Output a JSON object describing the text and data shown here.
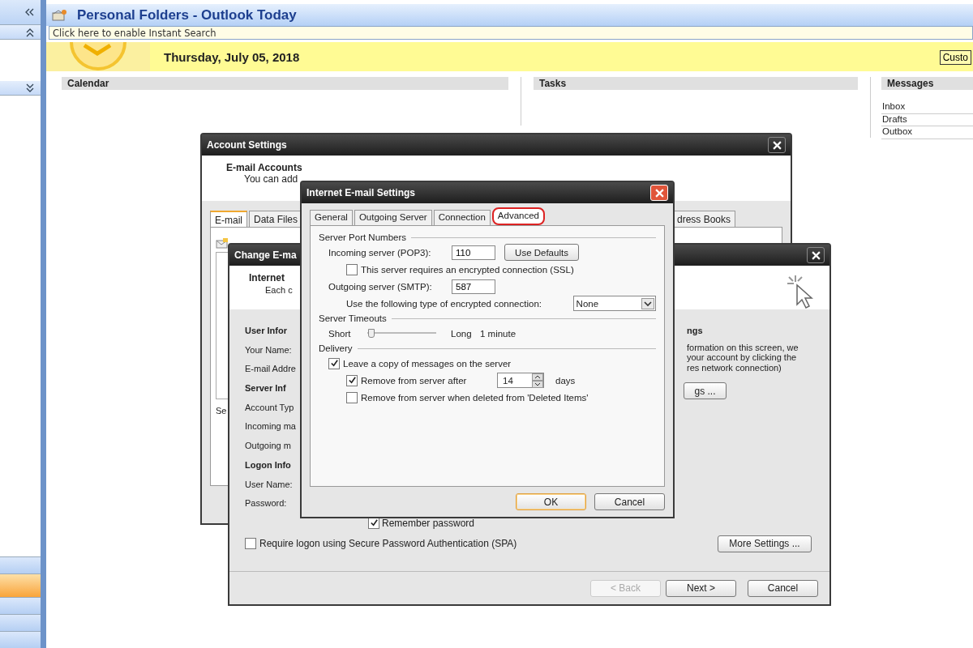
{
  "header": {
    "title": "Personal Folders - Outlook Today",
    "search": {
      "placeholder": "Click here to enable Instant Search"
    }
  },
  "today": {
    "date": "Thursday, July 05, 2018",
    "customize_button": "Custo"
  },
  "sections": [
    {
      "heading": "Calendar"
    },
    {
      "heading": "Tasks"
    },
    {
      "heading": "Messages",
      "items": [
        "Inbox",
        "Drafts",
        "Outbox"
      ]
    }
  ],
  "account_settings": {
    "title": "Account Settings",
    "heading": "E-mail Accounts",
    "description": "You can add",
    "tabs": [
      {
        "label": "E-mail",
        "selected": true
      },
      {
        "label": "Data Files",
        "selected": false
      },
      {
        "label": "dress Books",
        "selected": false
      }
    ],
    "cut_label": "Se"
  },
  "change_email": {
    "title": "Change E-ma",
    "heading": "Internet",
    "description": "Each c",
    "left_rows": [
      {
        "kind": "heading",
        "text": "User Infor"
      },
      {
        "kind": "label",
        "text": "Your Name:"
      },
      {
        "kind": "label",
        "text": "E-mail Addre"
      },
      {
        "kind": "heading",
        "text": "Server Inf"
      },
      {
        "kind": "label",
        "text": "Account Typ"
      },
      {
        "kind": "label",
        "text": "Incoming ma"
      },
      {
        "kind": "label",
        "text": "Outgoing m"
      },
      {
        "kind": "heading",
        "text": "Logon Info"
      },
      {
        "kind": "label",
        "text": "User Name:"
      },
      {
        "kind": "label",
        "text": "Password:"
      }
    ],
    "right_heading": "ngs",
    "right_lines": [
      "formation on this screen, we",
      "your account by clicking the",
      "res network connection)"
    ],
    "right_button": "gs ...",
    "remember_password": {
      "label": "Remember password",
      "checked": true
    },
    "spa": {
      "label": "Require logon using Secure Password Authentication (SPA)",
      "checked": false
    },
    "more_settings_button": "More Settings ...",
    "buttons": [
      {
        "label": "< Back",
        "disabled": true
      },
      {
        "label": "Next >",
        "disabled": false
      },
      {
        "label": "Cancel",
        "disabled": false
      }
    ]
  },
  "internet_email_settings": {
    "title": "Internet E-mail Settings",
    "tabs": [
      {
        "label": "General",
        "selected": false
      },
      {
        "label": "Outgoing Server",
        "selected": false
      },
      {
        "label": "Connection",
        "selected": false
      },
      {
        "label": "Advanced",
        "selected": true
      }
    ],
    "ports_group": "Server Port Numbers",
    "incoming": {
      "label": "Incoming server (POP3):",
      "value": "110",
      "button": "Use Defaults"
    },
    "ssl": {
      "label": "This server requires an encrypted connection (SSL)",
      "checked": false
    },
    "outgoing": {
      "label": "Outgoing server (SMTP):",
      "value": "587"
    },
    "encryption": {
      "label": "Use the following type of encrypted connection:",
      "value": "None"
    },
    "timeouts_group": "Server Timeouts",
    "timeout": {
      "short": "Short",
      "level": 0.05,
      "long": "Long",
      "reading": "1 minute"
    },
    "delivery_group": "Delivery",
    "leave_copy": {
      "label": "Leave a copy of messages on the server",
      "checked": true
    },
    "remove_after": {
      "label": "Remove from server after",
      "checked": true,
      "value": "14",
      "unit": "days"
    },
    "remove_deleted": {
      "label": "Remove from server when deleted from 'Deleted Items'",
      "checked": false
    },
    "buttons": [
      {
        "label": "OK",
        "default": true
      },
      {
        "label": "Cancel",
        "default": false
      }
    ]
  }
}
